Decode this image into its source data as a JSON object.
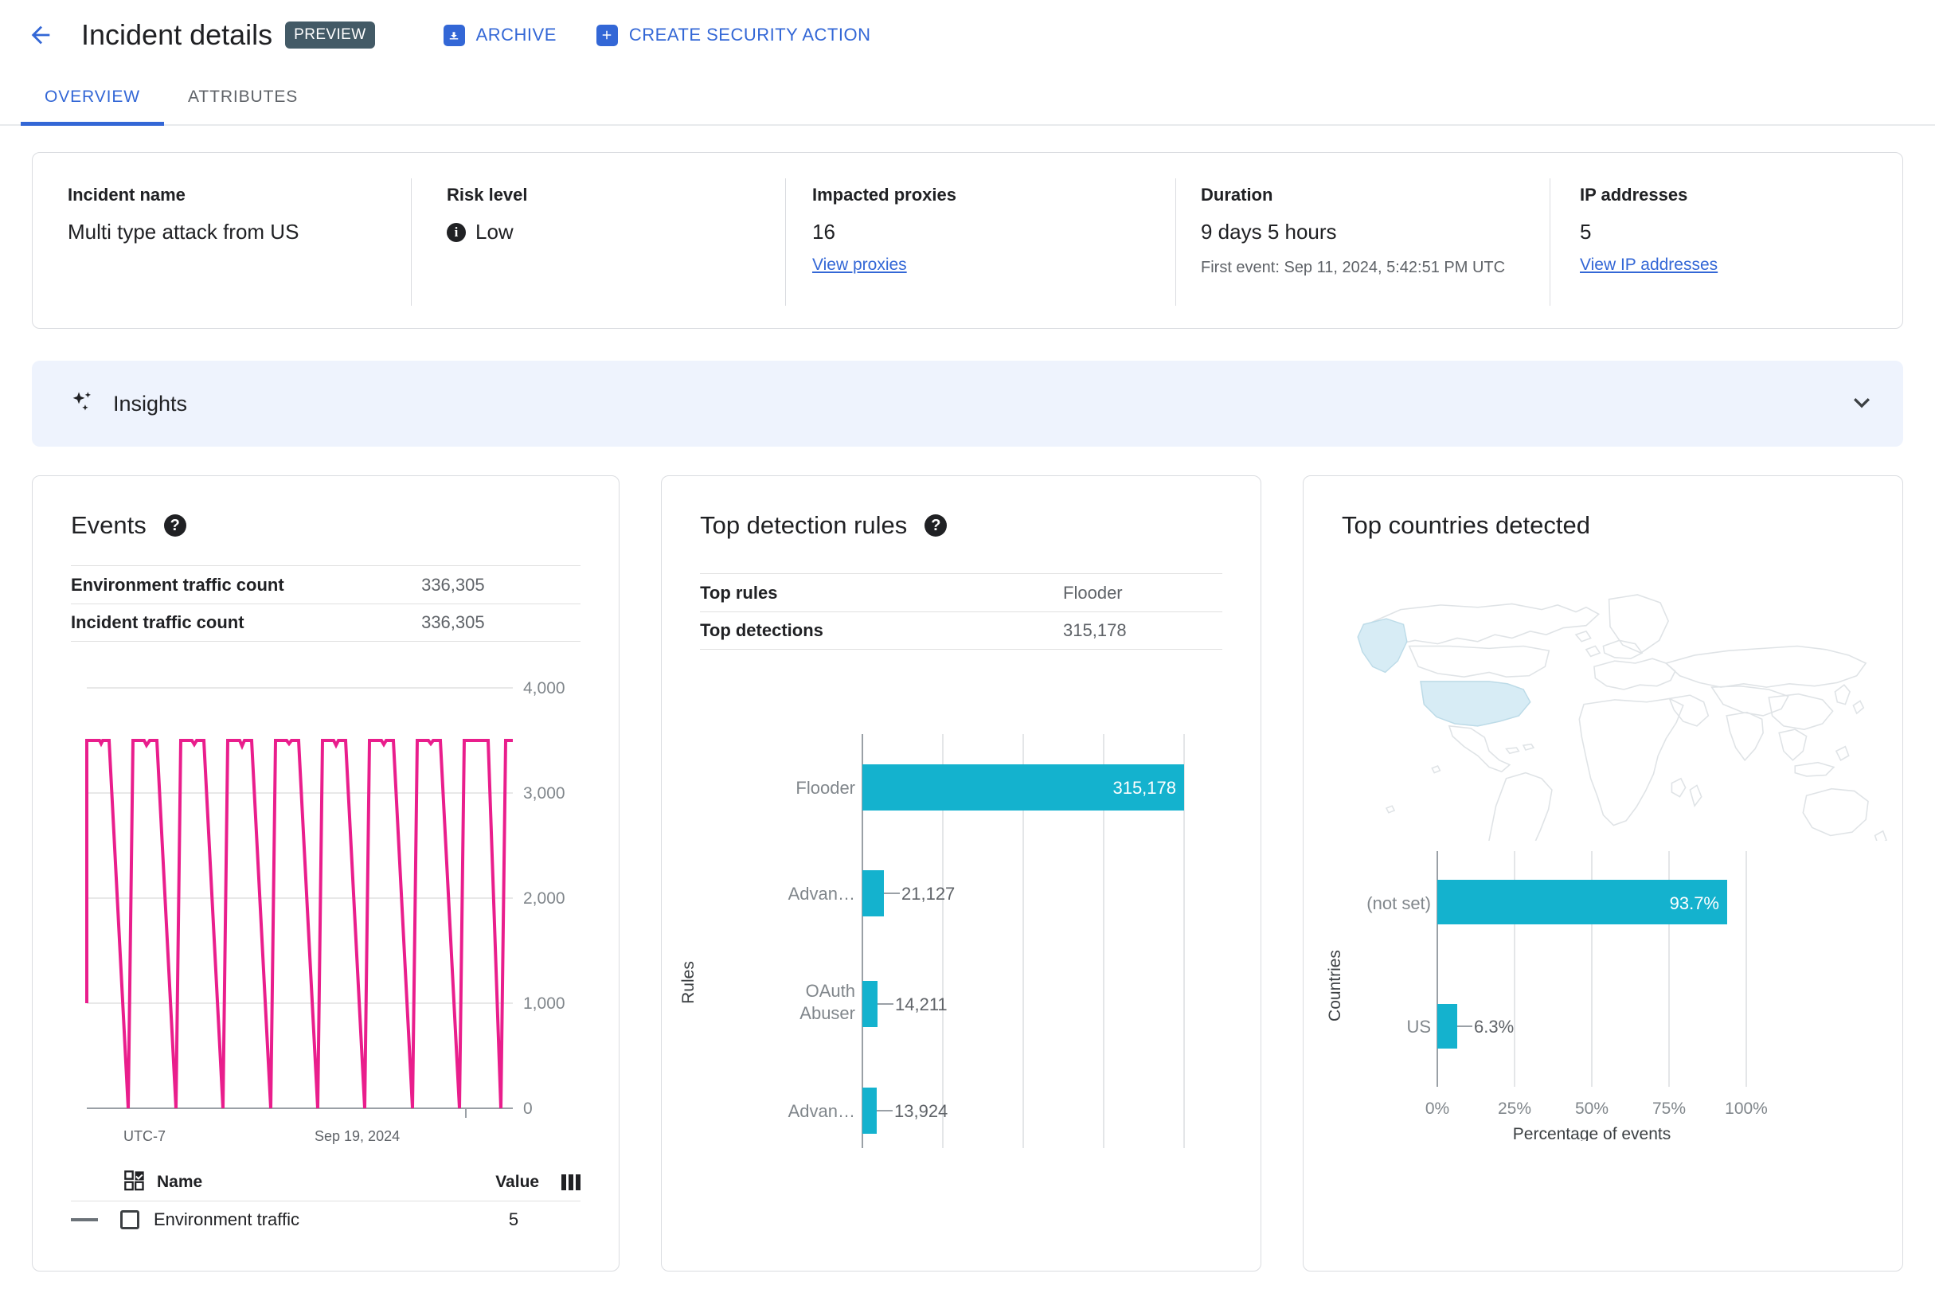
{
  "header": {
    "back_icon": "arrow-left-icon",
    "title": "Incident details",
    "preview_badge": "PREVIEW",
    "actions": [
      {
        "label": "ARCHIVE",
        "icon": "archive-download-icon"
      },
      {
        "label": "CREATE SECURITY ACTION",
        "icon": "plus-square-icon"
      }
    ],
    "accent_color": "#3367d6"
  },
  "tabs": [
    {
      "label": "OVERVIEW",
      "active": true
    },
    {
      "label": "ATTRIBUTES",
      "active": false
    }
  ],
  "summary": {
    "incident_name": {
      "label": "Incident name",
      "value": "Multi type attack from US"
    },
    "risk_level": {
      "label": "Risk level",
      "value": "Low",
      "icon": "info-icon"
    },
    "impacted_proxies": {
      "label": "Impacted proxies",
      "value": "16",
      "link": "View proxies"
    },
    "duration": {
      "label": "Duration",
      "value": "9 days 5 hours",
      "sub": "First event: Sep 11, 2024, 5:42:51 PM UTC"
    },
    "ip_addresses": {
      "label": "IP addresses",
      "value": "5",
      "link": "View IP addresses"
    }
  },
  "insights": {
    "title": "Insights",
    "sparkle_icon": "sparkle-icon",
    "chevron_icon": "chevron-down-icon",
    "background": "#eef3fd"
  },
  "events_panel": {
    "title": "Events",
    "help_icon": "help-icon",
    "stats": [
      {
        "key": "Environment traffic count",
        "value": "336,305"
      },
      {
        "key": "Incident traffic count",
        "value": "336,305"
      }
    ],
    "legend": {
      "checkbox_icon": "select-all-checkbox-icon",
      "name_header": "Name",
      "value_header": "Value",
      "columns_icon": "columns-icon",
      "rows": [
        {
          "name": "Environment traffic",
          "value": "5"
        }
      ]
    }
  },
  "rules_panel": {
    "title": "Top detection rules",
    "help_icon": "help-icon",
    "stats": [
      {
        "key": "Top rules",
        "value": "Flooder"
      },
      {
        "key": "Top detections",
        "value": "315,178"
      }
    ]
  },
  "countries_panel": {
    "title": "Top countries detected",
    "map": {
      "highlighted": [
        "US",
        "Alaska"
      ],
      "highlight_color": "#d5ecf5",
      "base_color": "#eceff1"
    }
  },
  "chart_data": [
    {
      "type": "line",
      "title": "Events",
      "xlabel": "",
      "ylabel": "",
      "ylim": [
        0,
        4000
      ],
      "yticks": [
        0,
        1000,
        2000,
        3000,
        4000
      ],
      "ytick_labels": [
        "0",
        "1,000",
        "2,000",
        "3,000",
        "4,000"
      ],
      "xtick_labels": [
        "UTC-7",
        "Sep 19, 2024"
      ],
      "series": [
        {
          "name": "Environment traffic",
          "color": "#e91e8c",
          "pattern": "sawtooth",
          "peak": 3500,
          "trough": 0,
          "cycles": 10,
          "values": [
            1000,
            3500,
            3500,
            0,
            3500,
            3480,
            3500,
            0,
            3500,
            3500,
            0,
            3500,
            3500,
            0,
            3500,
            3470,
            3500,
            0,
            3500,
            3500,
            0,
            3500,
            3480,
            3500,
            0,
            3500,
            3490,
            3500,
            0,
            3500,
            3500,
            0,
            3500,
            3500
          ]
        }
      ],
      "grid": true,
      "legend_position": "bottom"
    },
    {
      "type": "bar",
      "orientation": "horizontal",
      "title": "Top detection rules",
      "ylabel": "Rules",
      "xlabel": "",
      "categories": [
        "Flooder",
        "Advan…",
        "OAuth Abuser",
        "Advan…"
      ],
      "values": [
        315178,
        21127,
        14211,
        13924
      ],
      "value_labels": [
        "315,178",
        "21,127",
        "14,211",
        "13,924"
      ],
      "xlim": [
        0,
        370000
      ],
      "bar_color": "#14b2ce",
      "grid": true
    },
    {
      "type": "bar",
      "orientation": "horizontal",
      "title": "Top countries detected",
      "ylabel": "Countries",
      "xlabel": "Percentage of events",
      "categories": [
        "(not set)",
        "US"
      ],
      "values": [
        93.7,
        6.3
      ],
      "value_labels": [
        "93.7%",
        "6.3%"
      ],
      "xlim": [
        0,
        110
      ],
      "xticks": [
        0,
        25,
        50,
        75,
        100
      ],
      "xtick_labels": [
        "0%",
        "25%",
        "50%",
        "75%",
        "100%"
      ],
      "bar_color": "#14b2ce",
      "grid": true
    }
  ]
}
